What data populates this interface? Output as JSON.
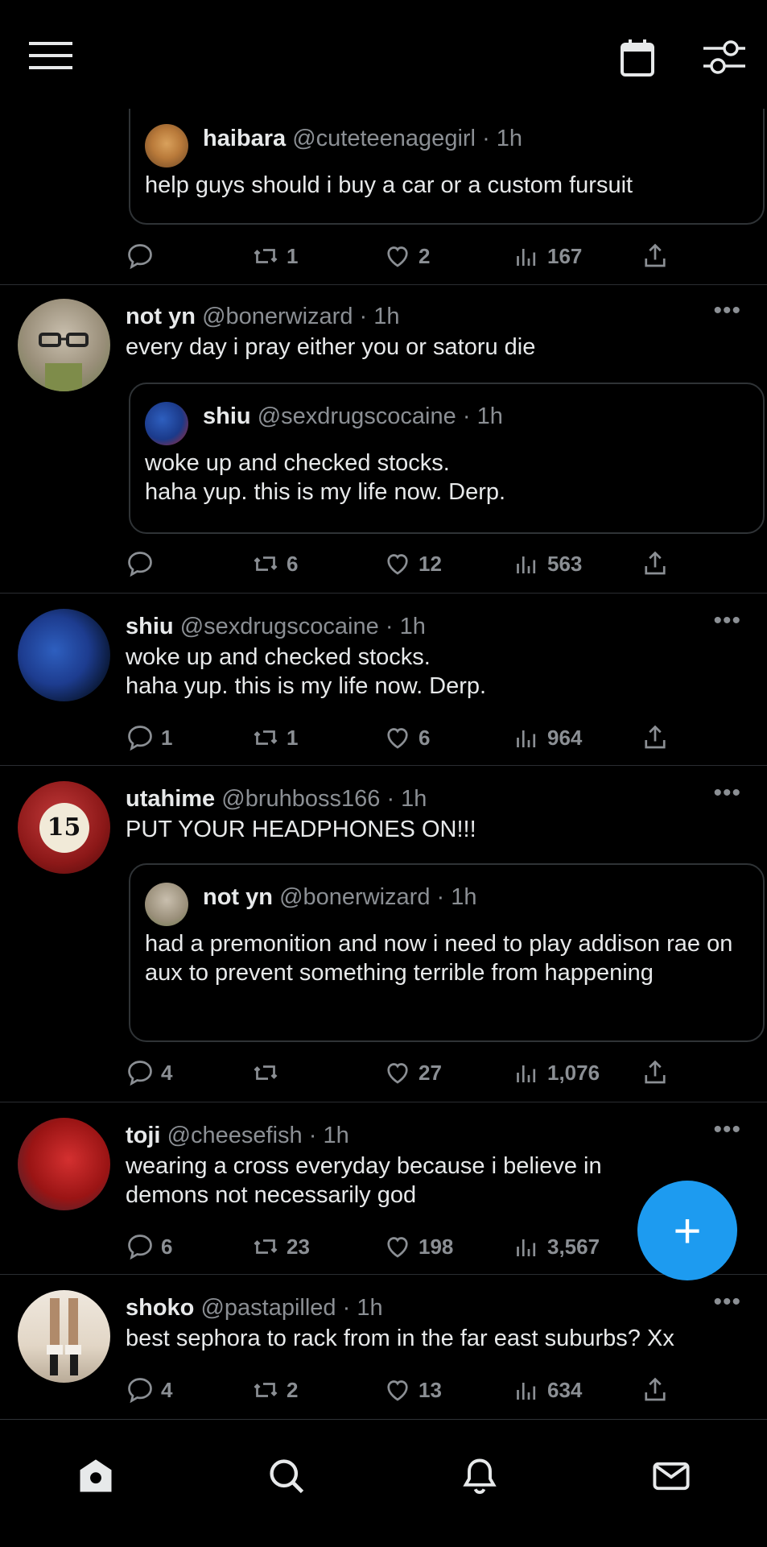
{
  "colors": {
    "background": "#000000",
    "text": "#e7e9ea",
    "muted": "#8b8f94",
    "accent": "#1d9bf0",
    "divider": "#2f3336"
  },
  "topbar": {
    "menu_icon": "hamburger-icon",
    "calendar_icon": "calendar-icon",
    "filter_icon": "sliders-icon"
  },
  "posts": [
    {
      "quote": {
        "name": "haibara",
        "handle": "@cuteteenagegirl",
        "dot": "·",
        "time": "1h",
        "text": "help guys should i buy a car or a custom fursuit"
      },
      "actions": {
        "reply": "",
        "retweet": "1",
        "like": "2",
        "views": "167"
      }
    },
    {
      "name": "not yn",
      "handle": "@bonerwizard",
      "dot": "·",
      "time": "1h",
      "more": "•••",
      "text": "every day i pray either you or satoru die",
      "quote": {
        "name": "shiu",
        "handle": "@sexdrugscocaine",
        "dot": "·",
        "time": "1h",
        "text": "woke up and checked stocks.\nhaha yup. this is my life now. Derp."
      },
      "actions": {
        "reply": "",
        "retweet": "6",
        "like": "12",
        "views": "563"
      }
    },
    {
      "name": "shiu",
      "handle": "@sexdrugscocaine",
      "dot": "·",
      "time": "1h",
      "more": "•••",
      "text": "woke up and checked stocks.\nhaha yup. this is my life now. Derp.",
      "actions": {
        "reply": "1",
        "retweet": "1",
        "like": "6",
        "views": "964"
      }
    },
    {
      "name": "utahime",
      "handle": "@bruhboss166",
      "dot": "·",
      "time": "1h",
      "more": "•••",
      "text": "PUT YOUR HEADPHONES ON!!!",
      "avatar_text": "15",
      "quote": {
        "name": "not yn",
        "handle": "@bonerwizard",
        "dot": "·",
        "time": "1h",
        "text": "had a premonition and now i need to play addison rae on aux to prevent something terrible from happening"
      },
      "actions": {
        "reply": "4",
        "retweet": "",
        "like": "27",
        "views": "1,076"
      }
    },
    {
      "name": "toji",
      "handle": "@cheesefish",
      "dot": "·",
      "time": "1h",
      "more": "•••",
      "text": "wearing a cross everyday because i believe in demons not necessarily god",
      "actions": {
        "reply": "6",
        "retweet": "23",
        "like": "198",
        "views": "3,567"
      }
    },
    {
      "name": "shoko",
      "handle": "@pastapilled",
      "dot": "·",
      "time": "1h",
      "more": "•••",
      "text": "best sephora to rack from in the far east suburbs? Xx",
      "actions": {
        "reply": "4",
        "retweet": "2",
        "like": "13",
        "views": "634"
      }
    }
  ],
  "fab": {
    "label": "+"
  },
  "bottombar": {
    "home_icon": "home-icon",
    "search_icon": "search-icon",
    "notifications_icon": "bell-icon",
    "messages_icon": "mail-icon"
  }
}
